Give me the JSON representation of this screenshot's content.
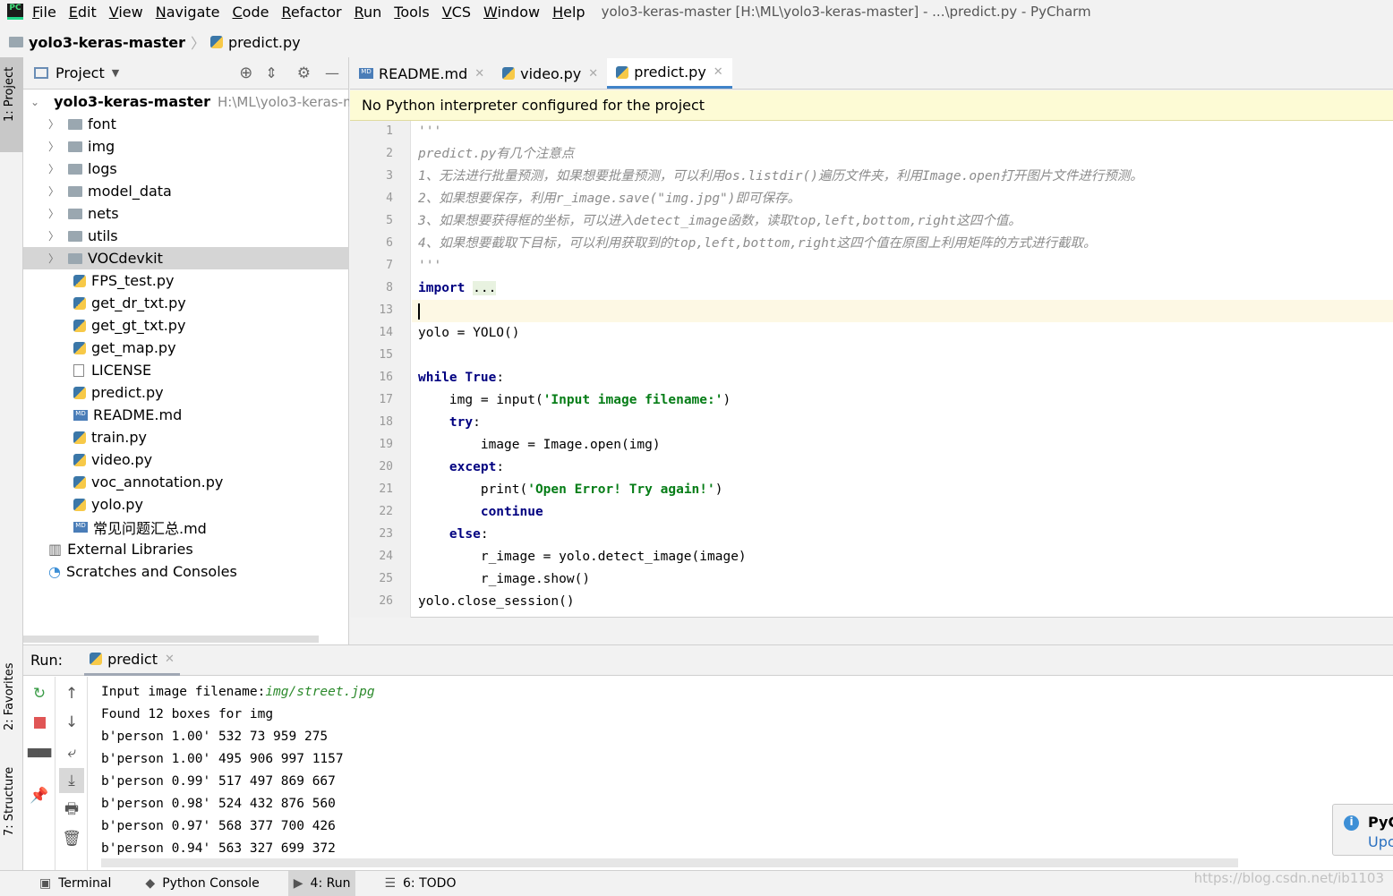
{
  "window": {
    "title": "yolo3-keras-master [H:\\ML\\yolo3-keras-master] - ...\\predict.py - PyCharm",
    "logo": "PC"
  },
  "menu": [
    "File",
    "Edit",
    "View",
    "Navigate",
    "Code",
    "Refactor",
    "Run",
    "Tools",
    "VCS",
    "Window",
    "Help"
  ],
  "breadcrumb": {
    "project": "yolo3-keras-master",
    "file": "predict.py"
  },
  "left_stripe": {
    "project": "1: Project",
    "favorites": "2: Favorites",
    "structure": "7: Structure"
  },
  "project_panel": {
    "title": "Project",
    "root": "yolo3-keras-master",
    "root_path": "H:\\ML\\yolo3-keras-ma",
    "items": [
      {
        "label": "font",
        "type": "folder"
      },
      {
        "label": "img",
        "type": "folder"
      },
      {
        "label": "logs",
        "type": "folder"
      },
      {
        "label": "model_data",
        "type": "folder"
      },
      {
        "label": "nets",
        "type": "folder"
      },
      {
        "label": "utils",
        "type": "folder"
      },
      {
        "label": "VOCdevkit",
        "type": "folder",
        "selected": true
      },
      {
        "label": "FPS_test.py",
        "type": "py"
      },
      {
        "label": "get_dr_txt.py",
        "type": "py"
      },
      {
        "label": "get_gt_txt.py",
        "type": "py"
      },
      {
        "label": "get_map.py",
        "type": "py"
      },
      {
        "label": "LICENSE",
        "type": "text"
      },
      {
        "label": "predict.py",
        "type": "py"
      },
      {
        "label": "README.md",
        "type": "md"
      },
      {
        "label": "train.py",
        "type": "py"
      },
      {
        "label": "video.py",
        "type": "py"
      },
      {
        "label": "voc_annotation.py",
        "type": "py"
      },
      {
        "label": "yolo.py",
        "type": "py"
      },
      {
        "label": "常见问题汇总.md",
        "type": "md"
      }
    ],
    "extra": [
      "External Libraries",
      "Scratches and Consoles"
    ]
  },
  "editor": {
    "tabs": [
      {
        "label": "README.md"
      },
      {
        "label": "video.py"
      },
      {
        "label": "predict.py",
        "active": true
      }
    ],
    "banner": "No Python interpreter configured for the project",
    "lines": [
      {
        "n": "1",
        "html": "<span class='cm'>'''</span>"
      },
      {
        "n": "2",
        "html": "<span class='cm'>predict.py有几个注意点</span>"
      },
      {
        "n": "3",
        "html": "<span class='cm'>1、无法进行批量预测，如果想要批量预测，可以利用os.listdir()遍历文件夹，利用Image.open打开图片文件进行预测。</span>"
      },
      {
        "n": "4",
        "html": "<span class='cm'>2、如果想要保存，利用r_image.save(\"img.jpg\")即可保存。</span>"
      },
      {
        "n": "5",
        "html": "<span class='cm'>3、如果想要获得框的坐标，可以进入detect_image函数，读取top,left,bottom,right这四个值。</span>"
      },
      {
        "n": "6",
        "html": "<span class='cm'>4、如果想要截取下目标，可以利用获取到的top,left,bottom,right这四个值在原图上利用矩阵的方式进行截取。</span>"
      },
      {
        "n": "7",
        "html": "<span class='cm'>'''</span>"
      },
      {
        "n": "8",
        "html": "<span class='kw'>import</span> <span style='background:#e8f2e0'>...</span>"
      },
      {
        "n": "13",
        "html": "",
        "current": true
      },
      {
        "n": "14",
        "html": "yolo = YOLO()"
      },
      {
        "n": "15",
        "html": ""
      },
      {
        "n": "16",
        "html": "<span class='kw'>while True</span>:"
      },
      {
        "n": "17",
        "html": "    img = input(<span class='st'>'Input image filename:'</span>)"
      },
      {
        "n": "18",
        "html": "    <span class='kw'>try</span>:"
      },
      {
        "n": "19",
        "html": "        image = Image.open(img)"
      },
      {
        "n": "20",
        "html": "    <span class='kw'>except</span>:"
      },
      {
        "n": "21",
        "html": "        print(<span class='st'>'Open Error! Try again!'</span>)"
      },
      {
        "n": "22",
        "html": "        <span class='kw'>continue</span>"
      },
      {
        "n": "23",
        "html": "    <span class='kw'>else</span>:"
      },
      {
        "n": "24",
        "html": "        r_image = yolo.detect_image(image)"
      },
      {
        "n": "25",
        "html": "        r_image.show()"
      },
      {
        "n": "26",
        "html": "yolo.close_session()"
      }
    ]
  },
  "run": {
    "label": "Run:",
    "tab": "predict",
    "prompt": "Input image filename:",
    "input": "img/street.jpg",
    "output": [
      "Found 12 boxes for img",
      "b'person 1.00' 532 73 959 275",
      "b'person 1.00' 495 906 997 1157",
      "b'person 0.99' 517 497 869 667",
      "b'person 0.98' 524 432 876 560",
      "b'person 0.97' 568 377 700 426",
      "b'person 0.94' 563 327 699 372"
    ]
  },
  "statusbar": [
    {
      "label": "Terminal",
      "icon": "terminal-icon"
    },
    {
      "label": "Python Console",
      "icon": "python-icon"
    },
    {
      "label": "4: Run",
      "icon": "run-icon",
      "active": true
    },
    {
      "label": "6: TODO",
      "icon": "list-icon"
    }
  ],
  "notification": {
    "title": "PyC",
    "link": "Upc"
  },
  "watermark": "https://blog.csdn.net/ib1103"
}
